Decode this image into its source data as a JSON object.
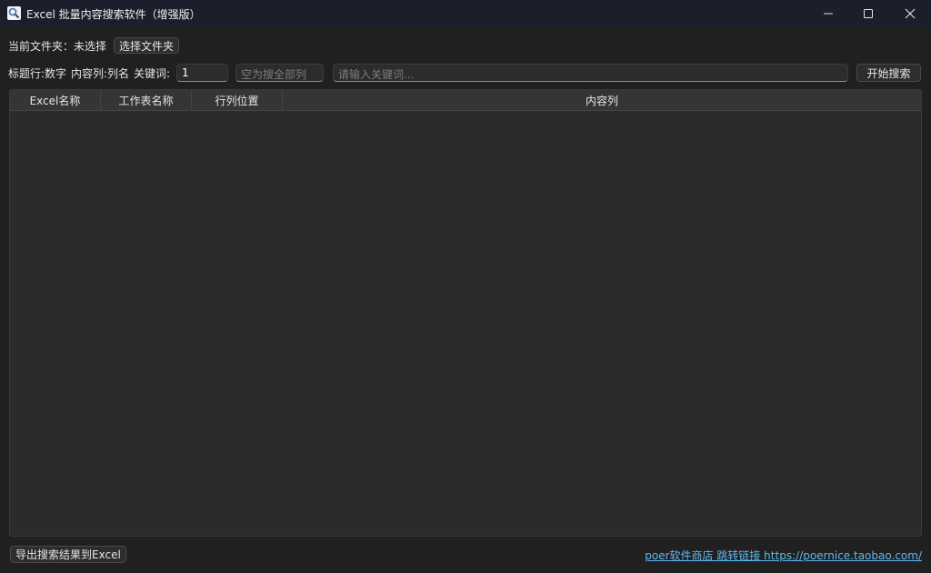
{
  "window": {
    "title": "Excel 批量内容搜索软件（增强版）",
    "app_icon": "magnifier-icon"
  },
  "folder": {
    "label": "当前文件夹：",
    "value": "未选择",
    "select_button": "选择文件夹"
  },
  "search": {
    "header_row_label": "标题行:数字",
    "content_col_label": "内容列:列名",
    "keyword_label": "关键词:",
    "header_row_value": "1",
    "content_col_placeholder": "空为搜全部列",
    "keyword_placeholder": "请输入关键词...",
    "start_button": "开始搜索"
  },
  "table": {
    "columns": [
      "Excel名称",
      "工作表名称",
      "行列位置",
      "内容列"
    ],
    "rows": []
  },
  "footer": {
    "export_button": "导出搜索结果到Excel",
    "store_link": "poer软件商店 跳转链接 https://poernice.taobao.com/"
  },
  "colors": {
    "background": "#202020",
    "titlebar": "#1c1f2b",
    "link": "#5fb8f0"
  }
}
